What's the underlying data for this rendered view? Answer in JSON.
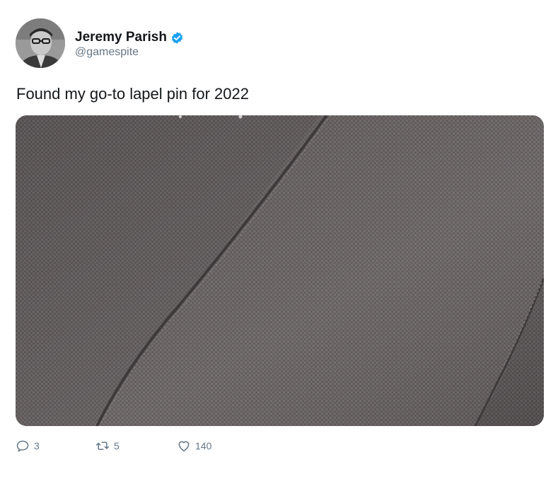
{
  "author": {
    "display_name": "Jeremy Parish",
    "handle": "@gamespite",
    "verified": true
  },
  "tweet": {
    "text": "Found my go-to lapel pin for 2022"
  },
  "actions": {
    "reply_count": "3",
    "retweet_count": "5",
    "like_count": "140"
  },
  "colors": {
    "accent": "#1da1f2",
    "muted": "#657786",
    "text": "#14171a"
  },
  "icons": [
    "verified-badge-icon",
    "reply-icon",
    "retweet-icon",
    "like-icon"
  ]
}
